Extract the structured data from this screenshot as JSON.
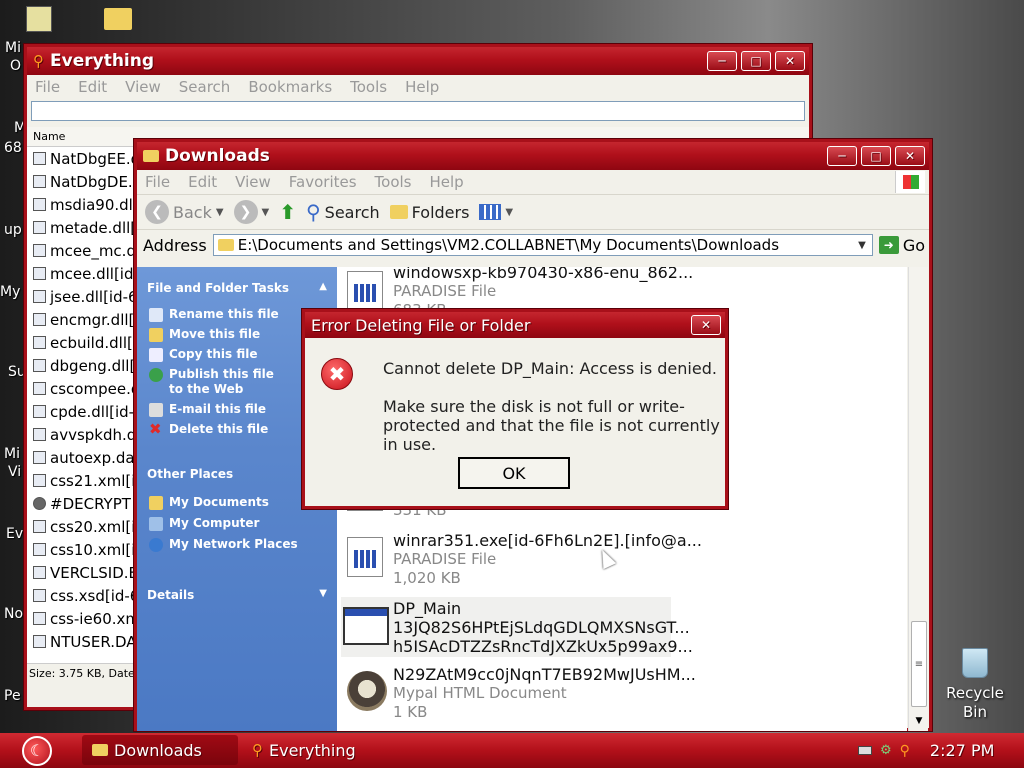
{
  "desktop": {
    "left_fragments": [
      "Mi",
      "O",
      "M",
      "68",
      "up",
      "My",
      "Su",
      "Mi",
      "Vi",
      "Ev",
      "No",
      "Pe"
    ],
    "recycle_bin_label": "Recycle Bin"
  },
  "everything": {
    "title": "Everything",
    "menu": [
      "File",
      "Edit",
      "View",
      "Search",
      "Bookmarks",
      "Tools",
      "Help"
    ],
    "search_value": "",
    "column_name": "Name",
    "rows": [
      "NatDbgEE.d",
      "NatDbgDE.d",
      "msdia90.dll[i",
      "metade.dll[i",
      "mcee_mc.da",
      "mcee.dll[id-",
      "jsee.dll[id-6",
      "encmgr.dll[i",
      "ecbuild.dll[i",
      "dbgeng.dll[i",
      "cscompee.d",
      "cpde.dll[id-6",
      "avvspkdh.dl",
      "autoexp.dat",
      "css21.xml[id",
      "#DECRYPT",
      "css20.xml[id",
      "css10.xml[id",
      "VERCLSID.E",
      "css.xsd[id-6",
      "css-ie60.xm",
      "NTUSER.DA"
    ],
    "status": "Size: 3.75 KB, Date M"
  },
  "explorer": {
    "title": "Downloads",
    "menu": [
      "File",
      "Edit",
      "View",
      "Favorites",
      "Tools",
      "Help"
    ],
    "toolbar": {
      "back": "Back",
      "search": "Search",
      "folders": "Folders"
    },
    "address_label": "Address",
    "address_value": "E:\\Documents and Settings\\VM2.COLLABNET\\My Documents\\Downloads",
    "go_label": "Go",
    "tasks": {
      "file_folder_title": "File and Folder Tasks",
      "file_items": [
        "Rename this file",
        "Move this file",
        "Copy this file",
        "Publish this file to the Web",
        "E-mail this file",
        "Delete this file"
      ],
      "other_title": "Other Places",
      "other_items": [
        "My Documents",
        "My Computer",
        "My Network Places"
      ],
      "details_title": "Details"
    },
    "files": [
      {
        "name": "windowsxp-kb970430-x86-enu_862...",
        "type": "PARADISE File",
        "size": "683 KB"
      },
      {
        "name": "",
        "type": "",
        "size": "331 KB"
      },
      {
        "name": "winrar351.exe[id-6Fh6Ln2E].[info@a...",
        "type": "PARADISE File",
        "size": "1,020 KB"
      },
      {
        "name": "DP_Main",
        "type": "13JQ82S6HPtEjSLdqGDLQMXSNsGT...",
        "size": "h5ISAcDTZZsRncTdJXZkUx5p99ax9..."
      },
      {
        "name": "N29ZAtM9cc0jNqnT7EB92MwJUsHM...",
        "type": "Mypal HTML Document",
        "size": "1 KB"
      }
    ]
  },
  "dialog": {
    "title": "Error Deleting File or Folder",
    "message": "Cannot delete DP_Main: Access is denied.",
    "detail": "Make sure the disk is not full or write-protected and that the file is not currently in use.",
    "ok_label": "OK"
  },
  "taskbar": {
    "tasks": [
      "Downloads",
      "Everything"
    ],
    "clock": "2:27 PM"
  },
  "colors": {
    "accent": "#b0101b",
    "taskpane": "#5a86cc",
    "error": "#d4202a"
  }
}
